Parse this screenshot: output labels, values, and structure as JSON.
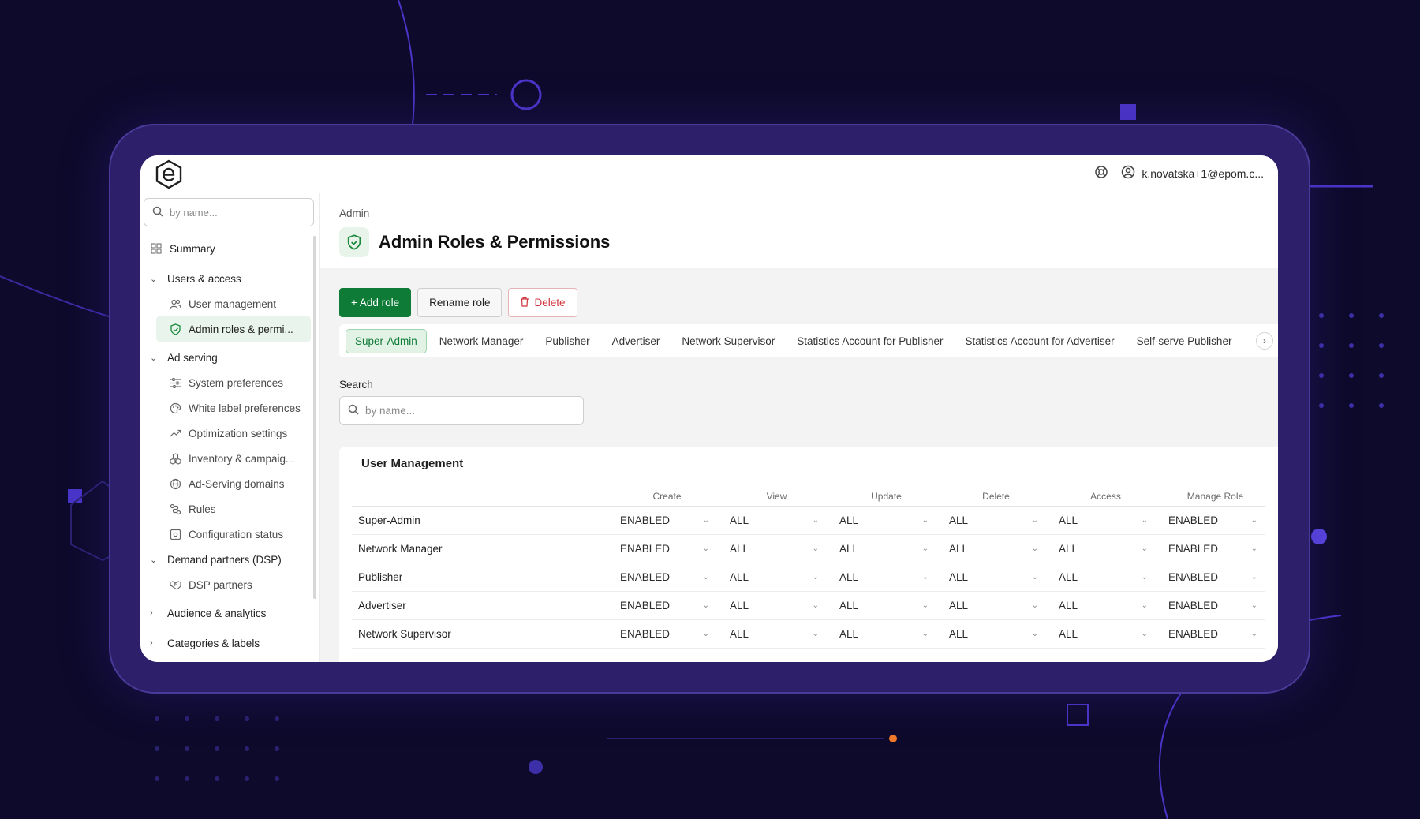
{
  "app": {
    "user_email": "k.novatska+1@epom.c..."
  },
  "sidebar": {
    "search_placeholder": "by name...",
    "summary": "Summary",
    "groups": [
      {
        "label": "Users & access",
        "expanded": true
      },
      {
        "label": "Ad serving",
        "expanded": true
      },
      {
        "label": "Demand partners (DSP)",
        "expanded": true
      },
      {
        "label": "Audience & analytics",
        "expanded": false
      },
      {
        "label": "Categories & labels",
        "expanded": false
      }
    ],
    "users_access_items": [
      "User management",
      "Admin roles & permi..."
    ],
    "ad_serving_items": [
      "System preferences",
      "White label preferences",
      "Optimization settings",
      "Inventory & campaig...",
      "Ad-Serving domains",
      "Rules",
      "Configuration status"
    ],
    "dsp_items": [
      "DSP partners"
    ]
  },
  "page": {
    "breadcrumb": "Admin",
    "title": "Admin Roles & Permissions"
  },
  "actions": {
    "add": "+ Add role",
    "rename": "Rename role",
    "delete": "Delete"
  },
  "role_tabs": [
    "Super-Admin",
    "Network Manager",
    "Publisher",
    "Advertiser",
    "Network Supervisor",
    "Statistics Account for Publisher",
    "Statistics Account for Advertiser",
    "Self-serve Publisher"
  ],
  "search": {
    "label": "Search",
    "placeholder": "by name..."
  },
  "permissions": {
    "section_title": "User Management",
    "columns": [
      "Create",
      "View",
      "Update",
      "Delete",
      "Access",
      "Manage Role"
    ],
    "rows": [
      {
        "role": "Super-Admin",
        "values": [
          "ENABLED",
          "ALL",
          "ALL",
          "ALL",
          "ALL",
          "ENABLED"
        ]
      },
      {
        "role": "Network Manager",
        "values": [
          "ENABLED",
          "ALL",
          "ALL",
          "ALL",
          "ALL",
          "ENABLED"
        ]
      },
      {
        "role": "Publisher",
        "values": [
          "ENABLED",
          "ALL",
          "ALL",
          "ALL",
          "ALL",
          "ENABLED"
        ]
      },
      {
        "role": "Advertiser",
        "values": [
          "ENABLED",
          "ALL",
          "ALL",
          "ALL",
          "ALL",
          "ENABLED"
        ]
      },
      {
        "role": "Network Supervisor",
        "values": [
          "ENABLED",
          "ALL",
          "ALL",
          "ALL",
          "ALL",
          "ENABLED"
        ]
      }
    ]
  },
  "colors": {
    "primary_green": "#0e7b36",
    "danger_red": "#d0333c",
    "background": "#0d0a2b",
    "device_frame": "#2e1f6b"
  }
}
